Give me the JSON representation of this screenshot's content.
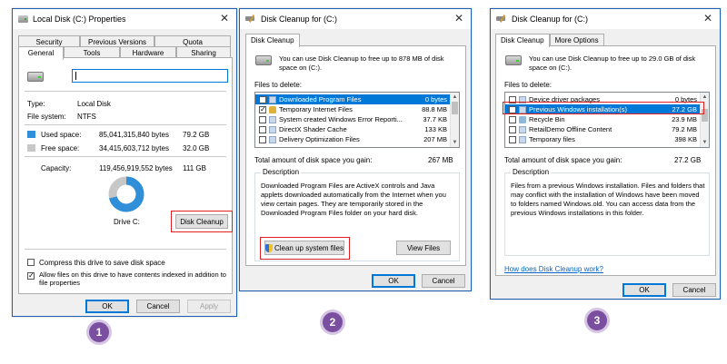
{
  "window1": {
    "title": "Local Disk (C:) Properties",
    "tabs_row1": [
      "Security",
      "Previous Versions",
      "Quota"
    ],
    "tabs_row2": [
      "General",
      "Tools",
      "Hardware",
      "Sharing"
    ],
    "name_value": "",
    "type_label": "Type:",
    "type_value": "Local Disk",
    "fs_label": "File system:",
    "fs_value": "NTFS",
    "used_label": "Used space:",
    "used_bytes": "85,041,315,840 bytes",
    "used_gb": "79.2 GB",
    "free_label": "Free space:",
    "free_bytes": "34,415,603,712 bytes",
    "free_gb": "32.0 GB",
    "capacity_label": "Capacity:",
    "capacity_bytes": "119,456,919,552 bytes",
    "capacity_gb": "111 GB",
    "used_fraction": 0.712,
    "drive_label": "Drive C:",
    "disk_cleanup_button": "Disk Cleanup",
    "compress_label": "Compress this drive to save disk space",
    "compress_checked": false,
    "index_label": "Allow files on this drive to have contents indexed in addition to file properties",
    "index_checked": true,
    "ok": "OK",
    "cancel": "Cancel",
    "apply": "Apply",
    "colors": {
      "used": "#2f8fd8",
      "free": "#c7c7c7"
    }
  },
  "window2": {
    "title": "Disk Cleanup for  (C:)",
    "tab": "Disk Cleanup",
    "intro": "You can use Disk Cleanup to free up to 878 MB of disk space on  (C:).",
    "files_label": "Files to delete:",
    "files": [
      {
        "name": "Downloaded Program Files",
        "size": "0 bytes",
        "checked": true,
        "selected": true
      },
      {
        "name": "Temporary Internet Files",
        "size": "88.8 MB",
        "checked": true,
        "selected": false
      },
      {
        "name": "System created Windows Error Reporti...",
        "size": "37.7 KB",
        "checked": false,
        "selected": false
      },
      {
        "name": "DirectX Shader Cache",
        "size": "133 KB",
        "checked": false,
        "selected": false
      },
      {
        "name": "Delivery Optimization Files",
        "size": "207 MB",
        "checked": false,
        "selected": false
      }
    ],
    "total_label": "Total amount of disk space you gain:",
    "total_value": "267 MB",
    "description_label": "Description",
    "description": "Downloaded Program Files are ActiveX controls and Java applets downloaded automatically from the Internet when you view certain pages. They are temporarily stored in the Downloaded Program Files folder on your hard disk.",
    "cleanup_system_button": "Clean up system files",
    "view_files_button": "View Files",
    "ok": "OK",
    "cancel": "Cancel"
  },
  "window3": {
    "title": "Disk Cleanup for  (C:)",
    "tabs": [
      "Disk Cleanup",
      "More Options"
    ],
    "intro": "You can use Disk Cleanup to free up to 29.0 GB of disk space on  (C:).",
    "files_label": "Files to delete:",
    "files": [
      {
        "name": "Device driver packages",
        "size": "0 bytes",
        "checked": false,
        "selected": false
      },
      {
        "name": "Previous Windows installation(s)",
        "size": "27.2 GB",
        "checked": true,
        "selected": true
      },
      {
        "name": "Recycle Bin",
        "size": "23.9 MB",
        "checked": false,
        "selected": false
      },
      {
        "name": "RetailDemo Offline Content",
        "size": "79.2 MB",
        "checked": false,
        "selected": false
      },
      {
        "name": "Temporary files",
        "size": "398 KB",
        "checked": false,
        "selected": false
      }
    ],
    "total_label": "Total amount of disk space you gain:",
    "total_value": "27.2 GB",
    "description_label": "Description",
    "description": "Files from a previous Windows installation.  Files and folders that may conflict with the installation of Windows have been moved to folders named Windows.old.  You can access data from the previous Windows installations in this folder.",
    "help_link": "How does Disk Cleanup work?",
    "ok": "OK",
    "cancel": "Cancel"
  },
  "steps": [
    "1",
    "2",
    "3"
  ]
}
